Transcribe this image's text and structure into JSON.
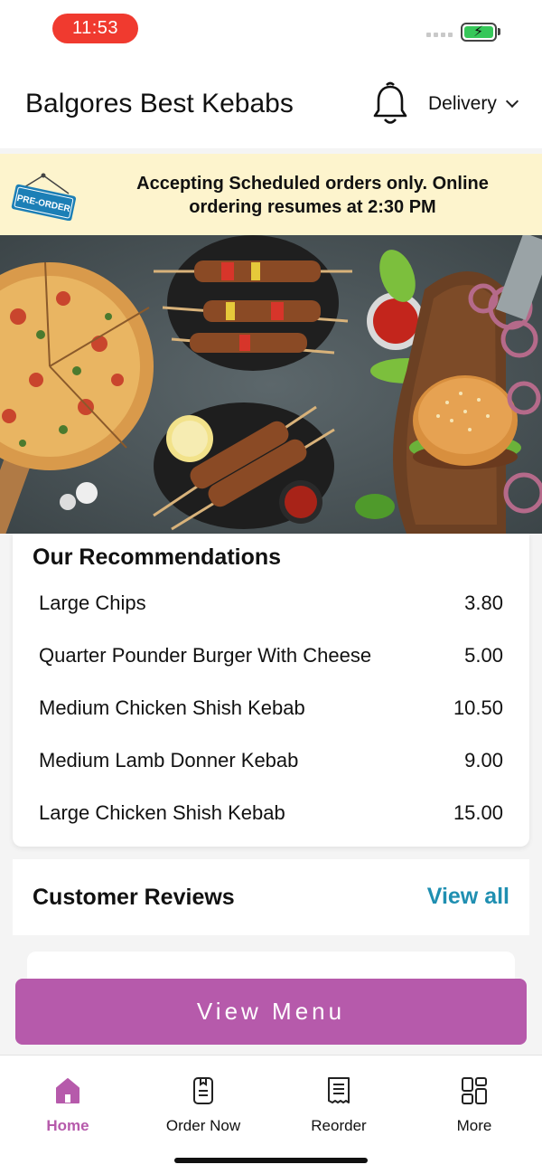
{
  "status": {
    "time": "11:53"
  },
  "header": {
    "title": "Balgores Best Kebabs",
    "delivery_label": "Delivery"
  },
  "banner": {
    "tag": "PRE-ORDER",
    "message": "Accepting Scheduled orders only. Online ordering resumes at 2:30 PM"
  },
  "recommendations": {
    "title": "Our Recommendations",
    "items": [
      {
        "name": "Large Chips",
        "price": "3.80"
      },
      {
        "name": "Quarter Pounder Burger With Cheese",
        "price": "5.00"
      },
      {
        "name": "Medium Chicken Shish Kebab",
        "price": "10.50"
      },
      {
        "name": "Medium Lamb Donner Kebab",
        "price": "9.00"
      },
      {
        "name": "Large Chicken Shish Kebab",
        "price": "15.00"
      }
    ]
  },
  "reviews": {
    "title": "Customer Reviews",
    "view_all": "View all"
  },
  "cta": {
    "label": "View Menu"
  },
  "tabbar": {
    "tabs": [
      {
        "label": "Home",
        "icon": "home-icon",
        "active": true
      },
      {
        "label": "Order Now",
        "icon": "order-icon",
        "active": false
      },
      {
        "label": "Reorder",
        "icon": "receipt-icon",
        "active": false
      },
      {
        "label": "More",
        "icon": "grid-icon",
        "active": false
      }
    ]
  },
  "colors": {
    "accent": "#b65aab",
    "link": "#1f8fb1",
    "banner_bg": "#fdf4cd",
    "time_pill": "#f03a2f"
  }
}
